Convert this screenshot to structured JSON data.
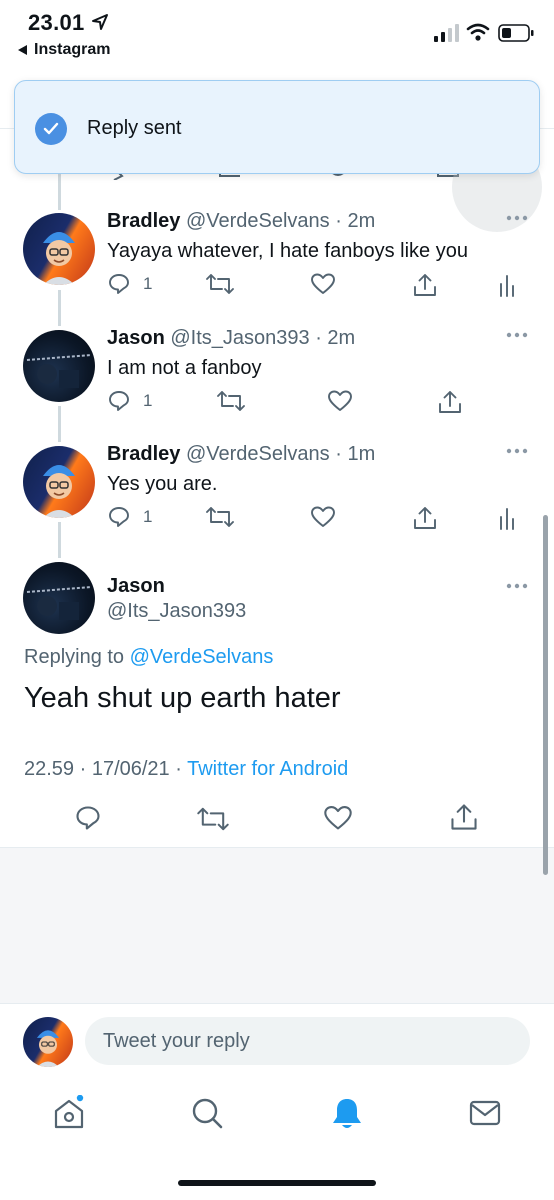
{
  "status_bar": {
    "time": "23.01",
    "back_app": "Instagram"
  },
  "toast": {
    "text": "Reply sent"
  },
  "thread": [
    {
      "name": "Bradley",
      "handle": "@VerdeSelvans",
      "time": "· 2m",
      "text": "Yayaya whatever, I hate fanboys like you",
      "reply_count": "1"
    },
    {
      "name": "Jason",
      "handle": "@Its_Jason393",
      "time": "· 2m",
      "text": "I am not a fanboy",
      "reply_count": "1"
    },
    {
      "name": "Bradley",
      "handle": "@VerdeSelvans",
      "time": "· 1m",
      "text": "Yes you are.",
      "reply_count": "1"
    }
  ],
  "focused": {
    "name": "Jason",
    "handle": "@Its_Jason393",
    "replying_prefix": "Replying to",
    "replying_to": "@VerdeSelvans",
    "text": "Yeah shut up earth hater",
    "timestamp": "22.59 · 17/06/21 ·",
    "source": "Twitter for Android"
  },
  "reply_bar": {
    "placeholder": "Tweet your reply"
  },
  "nav": {
    "active": "notifications",
    "accent": "#1d9bf0"
  }
}
